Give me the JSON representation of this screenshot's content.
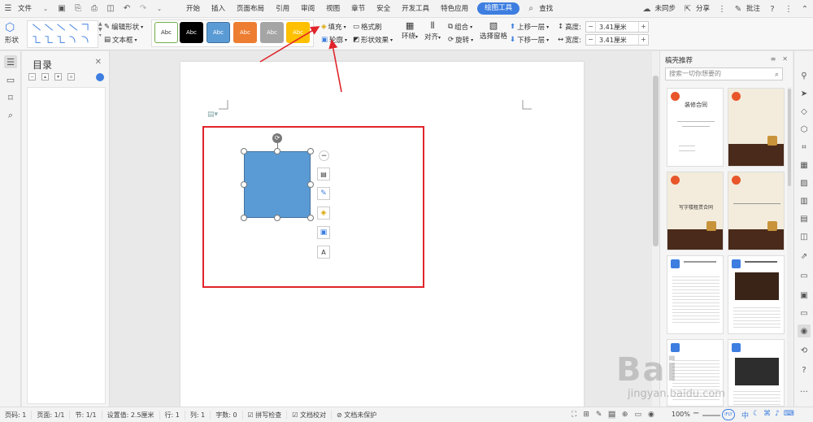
{
  "menubar": {
    "file_label": "文件",
    "tabs": [
      "开始",
      "插入",
      "页面布局",
      "引用",
      "审阅",
      "视图",
      "章节",
      "安全",
      "开发工具",
      "特色应用",
      "绘图工具"
    ],
    "search_label": "查找",
    "right": {
      "sync": "未同步",
      "share": "分享",
      "comment": "批注"
    }
  },
  "ribbon": {
    "shape_label": "形状",
    "edit_shape": "编辑形状",
    "textbox": "文本框",
    "styles": [
      {
        "label": "Abc",
        "bg": "#ffffff",
        "fg": "#333333",
        "border": "#70ad47"
      },
      {
        "label": "Abc",
        "bg": "#000000",
        "fg": "#ffffff",
        "border": "#000000"
      },
      {
        "label": "Abc",
        "bg": "#5b9bd5",
        "fg": "#ffffff",
        "border": "#41719c"
      },
      {
        "label": "Abc",
        "bg": "#ed7d31",
        "fg": "#ffffff",
        "border": "#ed7d31"
      },
      {
        "label": "Abc",
        "bg": "#a5a5a5",
        "fg": "#ffffff",
        "border": "#a5a5a5"
      },
      {
        "label": "Abc",
        "bg": "#ffc000",
        "fg": "#ffffff",
        "border": "#ffc000"
      }
    ],
    "fill": "填充",
    "format_brush": "格式刷",
    "outline": "轮廓",
    "shape_effect": "形状效果",
    "wrap": "环绕",
    "align": "对齐",
    "group": "组合",
    "rotate": "旋转",
    "select_pane": "选择窗格",
    "bring_forward": "上移一层",
    "send_backward": "下移一层",
    "height_label": "高度:",
    "height_value": "3.41厘米",
    "width_label": "宽度:",
    "width_value": "3.41厘米"
  },
  "toc": {
    "title": "目录"
  },
  "right_panel": {
    "title": "稿壳推荐",
    "search_placeholder": "搜索一切你想要的",
    "cards": [
      {
        "title": "装修合同",
        "theme": "light"
      },
      {
        "title": "",
        "theme": "dark"
      },
      {
        "title": "写字楼租赁合同",
        "theme": "dark"
      },
      {
        "title": "",
        "theme": "dark"
      },
      {
        "title": "",
        "theme": "doc"
      },
      {
        "title": "",
        "theme": "doc"
      },
      {
        "title": "",
        "theme": "doc"
      },
      {
        "title": "",
        "theme": "doc"
      }
    ]
  },
  "status": {
    "pages": "页码: 1",
    "page_of": "页面: 1/1",
    "section": "节: 1/1",
    "setting": "设置值: 2.5厘米",
    "row": "行: 1",
    "col": "列: 1",
    "wordcount": "字数: 0",
    "spellcheck": "拼写检查",
    "proofread": "文档校对",
    "unprotected": "文档未保护",
    "zoom": "100%"
  },
  "watermark": {
    "main": "Bai",
    "sub": "jingyan.baidu.com"
  },
  "colors": {
    "accent": "#3d7ee0",
    "annotation": "#e0242a",
    "shape_fill": "#5b9bd5"
  }
}
